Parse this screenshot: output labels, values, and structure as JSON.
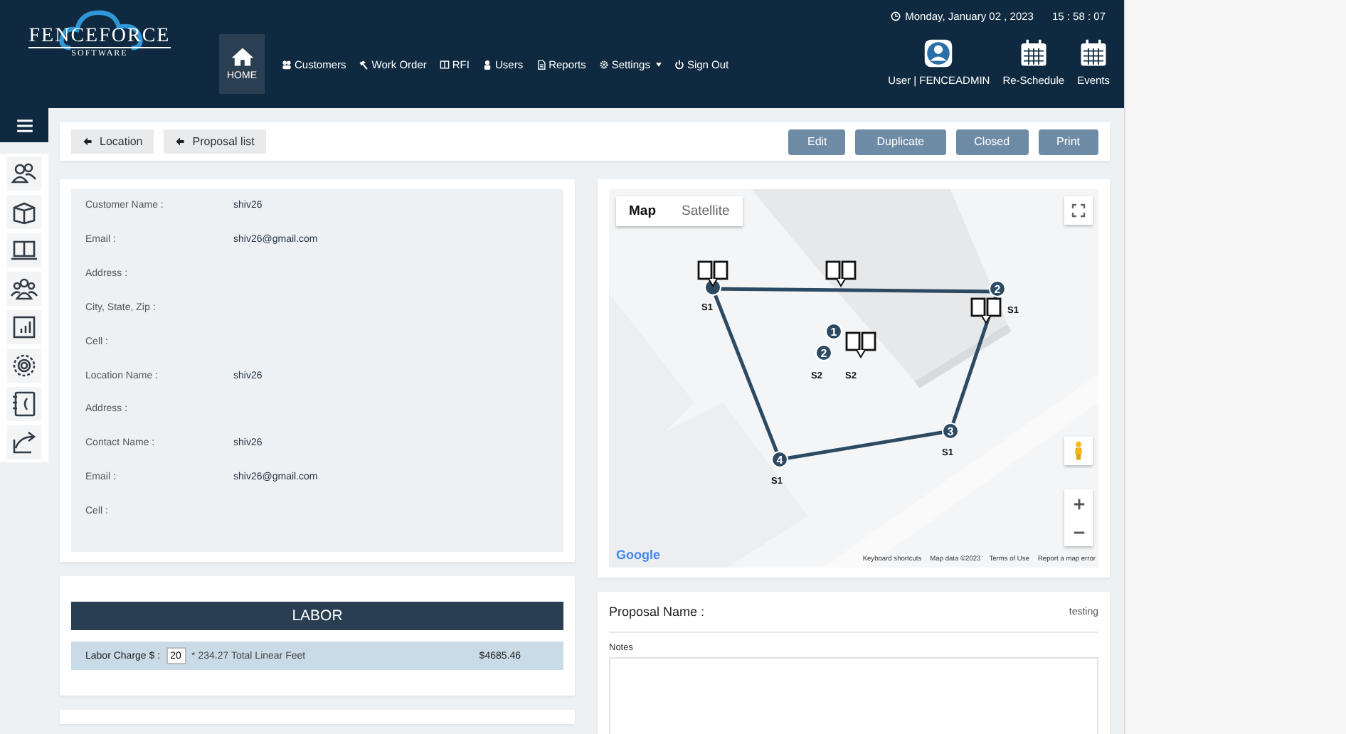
{
  "header": {
    "logo": {
      "name": "FENCEFORCE",
      "tagline": "SOFTWARE"
    },
    "nav": [
      {
        "label": "HOME",
        "kind": "home",
        "selected": true
      },
      {
        "label": "Customers",
        "kind": "customers",
        "selected": false
      },
      {
        "label": "Work Order",
        "kind": "workorder",
        "selected": false
      },
      {
        "label": "RFI",
        "kind": "rfi",
        "selected": false
      },
      {
        "label": "Users",
        "kind": "users",
        "selected": false
      },
      {
        "label": "Reports",
        "kind": "reports",
        "selected": false
      },
      {
        "label": "Settings",
        "kind": "settings",
        "selected": false,
        "dropdown": true
      },
      {
        "label": "Sign Out",
        "kind": "signout",
        "selected": false
      }
    ],
    "datetime": {
      "date": "Monday, January 02 , 2023",
      "time": "15 : 58 : 07"
    },
    "shortcuts": [
      {
        "label": "User | FENCEADMIN",
        "kind": "user"
      },
      {
        "label": "Re-Schedule",
        "kind": "calendar"
      },
      {
        "label": "Events",
        "kind": "calendar"
      }
    ]
  },
  "toolbar": {
    "back_buttons": [
      "Location",
      "Proposal list"
    ],
    "actions": [
      "Edit",
      "Duplicate",
      "Closed",
      "Print"
    ]
  },
  "details": [
    {
      "label": "Customer Name :",
      "value": "shiv26"
    },
    {
      "label": "Email :",
      "value": "shiv26@gmail.com"
    },
    {
      "label": "Address :"
    },
    {
      "label": "City, State, Zip :"
    },
    {
      "label": "Cell :"
    },
    {
      "label": "Location Name :",
      "value": "shiv26"
    },
    {
      "label": "Address :"
    },
    {
      "label": "Contact Name :",
      "value": "shiv26"
    },
    {
      "label": "Email :",
      "value": "shiv26@gmail.com"
    },
    {
      "label": "Cell :"
    }
  ],
  "map": {
    "tabs": [
      {
        "label": "Map",
        "selected": true
      },
      {
        "label": "Satellite",
        "selected": false
      }
    ],
    "markers": [
      {
        "label": "S1"
      },
      {
        "number": "2",
        "label": "S1"
      },
      {
        "number": "3",
        "label": "S1"
      },
      {
        "number": "4",
        "label": "S1"
      },
      {
        "number": "1",
        "label": "S2"
      },
      {
        "number": "2",
        "label": "S2"
      }
    ],
    "logo": "Google",
    "footer": [
      "Keyboard shortcuts",
      "Map data ©2023",
      "Terms of Use",
      "Report a map error"
    ]
  },
  "labor": {
    "title": "LABOR",
    "label": "Labor Charge $ :",
    "rate": "20",
    "formula": "* 234.27 Total Linear Feet",
    "total": "$4685.46"
  },
  "proposal": {
    "label": "Proposal Name :",
    "value": "testing",
    "notes_label": "Notes"
  }
}
